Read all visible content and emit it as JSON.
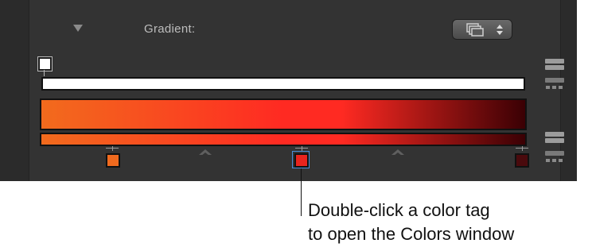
{
  "inspector": {
    "gradient_label": "Gradient:",
    "icons": {
      "disclosure": "disclosure-triangle-icon",
      "preset_menu": "stacked-layers-icon",
      "menu_arrows": "up-down-arrows-icon",
      "add_remove": "list-buttons-icon"
    }
  },
  "gradient_editor": {
    "opacity_tags": [
      {
        "color": "#ffffff",
        "position": 0.0
      }
    ],
    "color_tags": [
      {
        "color": "#f06a1e",
        "position": 0.0
      },
      {
        "color": "#e8241d",
        "position": 0.5,
        "selected": true
      },
      {
        "color": "#4a0a0d",
        "position": 1.0
      }
    ],
    "gradient_colors": [
      "#f26b1d",
      "#ff2a22",
      "#3a0004"
    ],
    "selection_color": "#4a90d9"
  },
  "callout": {
    "line1": "Double-click a color tag",
    "line2": "to open the Colors window"
  }
}
